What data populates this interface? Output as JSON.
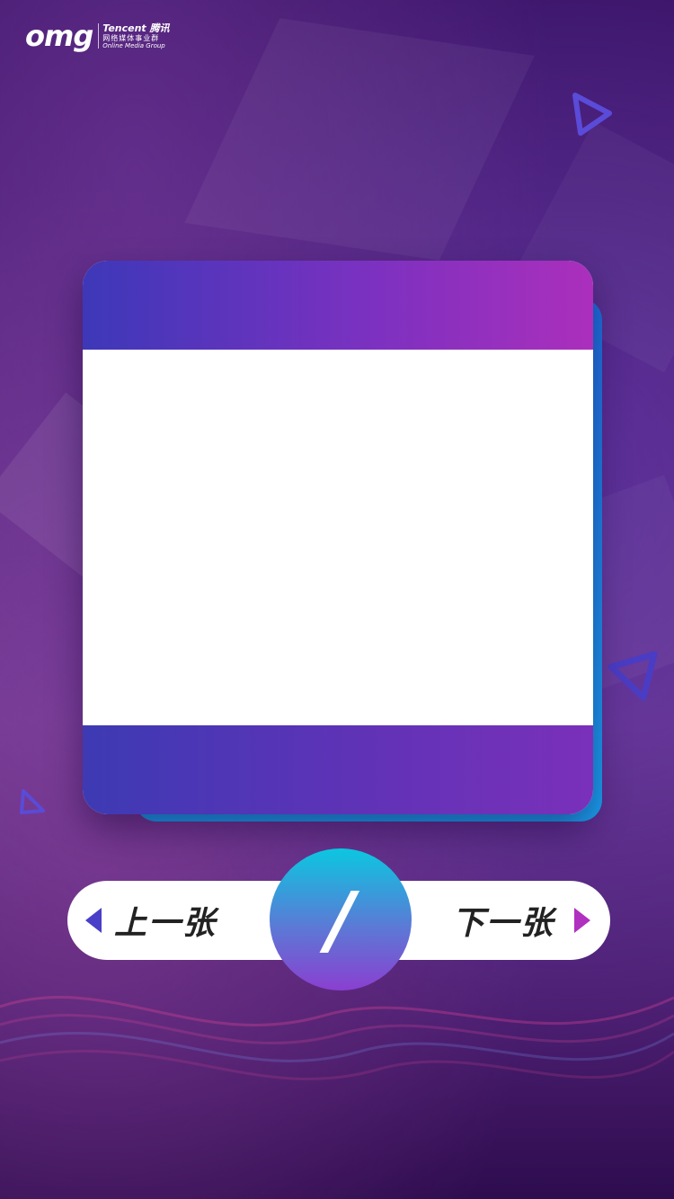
{
  "logo": {
    "brand": "omg",
    "company": "Tencent 腾讯",
    "division_cn": "网络媒体事业群",
    "division_en": "Online Media Group"
  },
  "navigation": {
    "prev_label": "上一张",
    "next_label": "下一张",
    "page_separator": "/"
  },
  "colors": {
    "card_top_gradient": [
      "#3d38b8",
      "#ab2fbc"
    ],
    "card_bottom_gradient": [
      "#3d3ab4",
      "#7a30ba"
    ],
    "card_back": "#1a8df0",
    "prev_arrow": "#4a3fc8",
    "next_arrow": "#b030c0",
    "page_circle_gradient": [
      "#0bc7e0",
      "#8a3fd0"
    ]
  },
  "icons": {
    "prev": "caret-left-icon",
    "next": "caret-right-icon"
  }
}
